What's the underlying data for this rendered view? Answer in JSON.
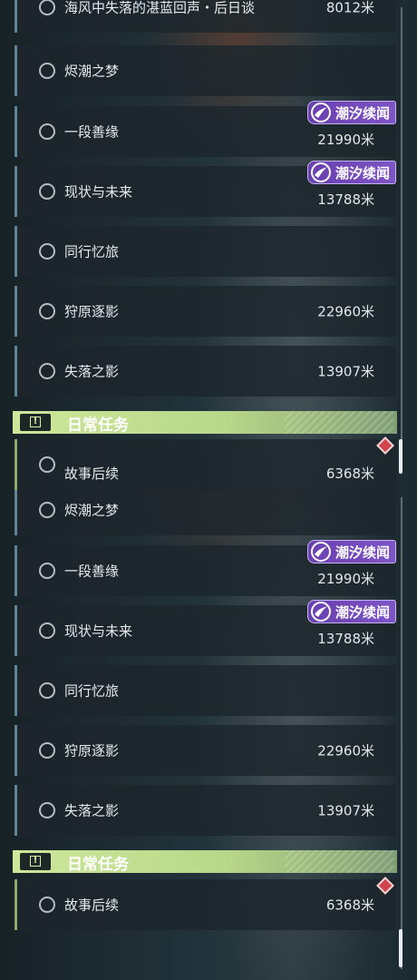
{
  "top_list": {
    "rows": [
      {
        "title": "海风中失落的湛蓝回声・后日谈",
        "distance": "8012米"
      },
      {
        "title": "烬潮之梦",
        "distance": ""
      },
      {
        "title": "一段善缘",
        "distance": "21990米",
        "badge": "潮汐续闻"
      },
      {
        "title": "现状与未来",
        "distance": "13788米",
        "badge": "潮汐续闻"
      },
      {
        "title": "同行忆旅",
        "distance": ""
      },
      {
        "title": "狩原逐影",
        "distance": "22960米"
      },
      {
        "title": "失落之影",
        "distance": "13907米"
      }
    ],
    "section_title": "日常任务",
    "daily_rows": [
      {
        "title": "故事后续",
        "distance": "6368米"
      }
    ]
  },
  "bottom_list": {
    "rows": [
      {
        "title": "烬潮之梦",
        "distance": ""
      },
      {
        "title": "一段善缘",
        "distance": "21990米",
        "badge": "潮汐续闻"
      },
      {
        "title": "现状与未来",
        "distance": "13788米",
        "badge": "潮汐续闻"
      },
      {
        "title": "同行忆旅",
        "distance": ""
      },
      {
        "title": "狩原逐影",
        "distance": "22960米"
      },
      {
        "title": "失落之影",
        "distance": "13907米"
      }
    ],
    "section_title": "日常任务",
    "daily_rows": [
      {
        "title": "故事后续",
        "distance": "6368米"
      }
    ]
  },
  "icons": {
    "status": "empty-circle-icon",
    "badge": "tide-swirl-icon",
    "section": "exclamation-icon",
    "alert": "red-diamond-icon"
  },
  "colors": {
    "badge": "#7e55c6",
    "section": "#cde79a",
    "row_accent": "#5f8597",
    "alert": "#d2444c"
  }
}
